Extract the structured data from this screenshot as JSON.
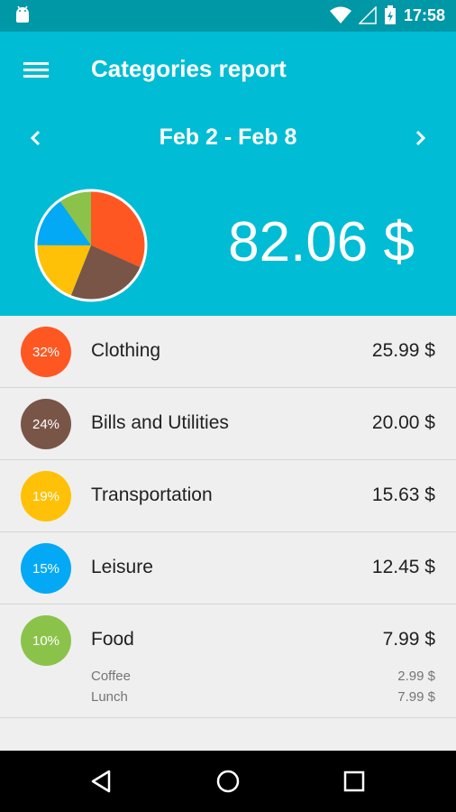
{
  "status": {
    "time": "17:58"
  },
  "header": {
    "title": "Categories report",
    "date_range": "Feb 2 - Feb 8",
    "total": "82.06 $"
  },
  "categories": [
    {
      "pct": "32%",
      "name": "Clothing",
      "amount": "25.99 $",
      "color": "#ff5722",
      "share": 0.3167
    },
    {
      "pct": "24%",
      "name": "Bills and Utilities",
      "amount": "20.00 $",
      "color": "#795548",
      "share": 0.2437
    },
    {
      "pct": "19%",
      "name": "Transportation",
      "amount": "15.63 $",
      "color": "#ffc107",
      "share": 0.1905
    },
    {
      "pct": "15%",
      "name": "Leisure",
      "amount": "12.45 $",
      "color": "#03a9f4",
      "share": 0.1517
    },
    {
      "pct": "10%",
      "name": "Food",
      "amount": "7.99 $",
      "color": "#8bc34a",
      "share": 0.0974,
      "sub": [
        {
          "name": "Coffee",
          "amount": "2.99 $"
        },
        {
          "name": "Lunch",
          "amount": "7.99 $"
        }
      ]
    }
  ],
  "icons": {
    "menu": "hamburger-icon",
    "prev": "chevron-left-icon",
    "next": "chevron-right-icon"
  },
  "colors": {
    "toolbar": "#00bcd4",
    "statusbar": "#0097a7"
  }
}
